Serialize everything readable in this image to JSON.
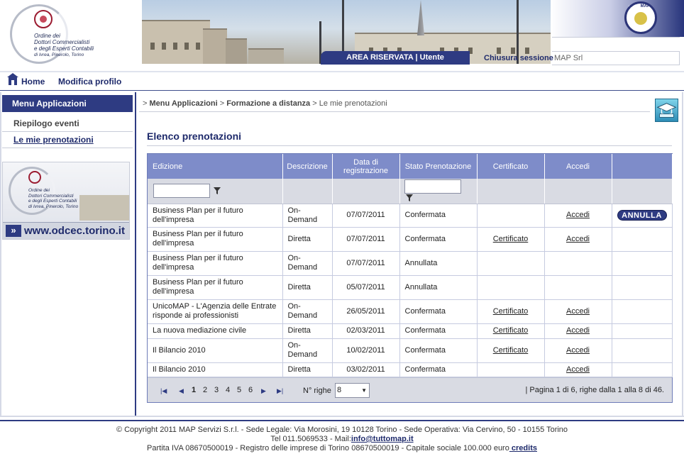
{
  "logo": {
    "line1": "Ordine dei",
    "line2": "Dottori Commercialisti",
    "line3": "e degli Esperti Contabili",
    "line4": "di Ivrea, Pinerolo, Torino"
  },
  "brand": {
    "by": "by",
    "name": "MAP"
  },
  "header": {
    "area_label": "AREA RISERVATA | Utente",
    "close_session": "Chiusura sessione",
    "user_name": "MAP Srl"
  },
  "topnav": {
    "home": "Home",
    "edit_profile": "Modifica profilo"
  },
  "sidebar": {
    "title": "Menu Applicazioni",
    "items": [
      {
        "label": "Riepilogo eventi"
      },
      {
        "label": "Le mie prenotazioni"
      }
    ],
    "banner_url": "www.odcec.torino.it"
  },
  "breadcrumb": {
    "part1": "Menu Applicazioni",
    "part2": "Formazione a distanza",
    "part3": "Le mie prenotazioni"
  },
  "page_title": "Elenco prenotazioni",
  "table": {
    "columns": [
      "Edizione",
      "Descrizione",
      "Data di registrazione",
      "Stato Prenotazione",
      "Certificato",
      "Accedi",
      ""
    ],
    "rows": [
      {
        "edizione": "Business Plan per il futuro dell'impresa",
        "descrizione": "On-Demand",
        "data": "07/07/2011",
        "stato": "Confermata",
        "certificato": "",
        "accedi": "Accedi",
        "action": "ANNULLA"
      },
      {
        "edizione": "Business Plan per il futuro dell'impresa",
        "descrizione": "Diretta",
        "data": "07/07/2011",
        "stato": "Confermata",
        "certificato": "Certificato",
        "accedi": "Accedi",
        "action": ""
      },
      {
        "edizione": "Business Plan per il futuro dell'impresa",
        "descrizione": "On-Demand",
        "data": "07/07/2011",
        "stato": "Annullata",
        "certificato": "",
        "accedi": "",
        "action": ""
      },
      {
        "edizione": "Business Plan per il futuro dell'impresa",
        "descrizione": "Diretta",
        "data": "05/07/2011",
        "stato": "Annullata",
        "certificato": "",
        "accedi": "",
        "action": ""
      },
      {
        "edizione": "UnicoMAP - L'Agenzia delle Entrate risponde ai professionisti",
        "descrizione": "On-Demand",
        "data": "26/05/2011",
        "stato": "Confermata",
        "certificato": "Certificato",
        "accedi": "Accedi",
        "action": ""
      },
      {
        "edizione": "La nuova mediazione civile",
        "descrizione": "Diretta",
        "data": "02/03/2011",
        "stato": "Confermata",
        "certificato": "Certificato",
        "accedi": "Accedi",
        "action": ""
      },
      {
        "edizione": "Il Bilancio 2010",
        "descrizione": "On-Demand",
        "data": "10/02/2011",
        "stato": "Confermata",
        "certificato": "Certificato",
        "accedi": "Accedi",
        "action": ""
      },
      {
        "edizione": "Il Bilancio 2010",
        "descrizione": "Diretta",
        "data": "03/02/2011",
        "stato": "Confermata",
        "certificato": "",
        "accedi": "Accedi",
        "action": ""
      }
    ]
  },
  "pager": {
    "pages": [
      "1",
      "2",
      "3",
      "4",
      "5",
      "6"
    ],
    "current_page": "1",
    "rows_label": "N° righe",
    "rows_value": "8",
    "info": "| Pagina 1 di 6, righe dalla 1 alla 8 di 46."
  },
  "footer": {
    "line1": "© Copyright 2011 MAP Servizi S.r.l. - Sede Legale: Via Morosini, 19 10128 Torino - Sede Operativa: Via Cervino, 50 - 10155 Torino",
    "line2_prefix": "Tel 011.5069533 - Mail:",
    "email": "info@tuttomap.it",
    "line3_prefix": "Partita IVA 08670500019  -  Registro delle imprese di Torino 08670500019 - Capitale sociale 100.000 euro",
    "credits": " credits"
  },
  "colors": {
    "accent": "#2e3b82",
    "header_row": "#7e8cc9",
    "filter_row": "#d9dbe3"
  }
}
